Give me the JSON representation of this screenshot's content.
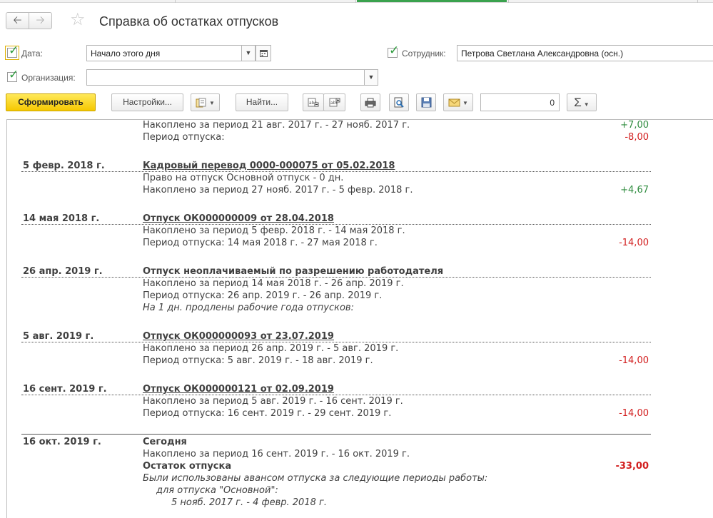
{
  "window": {
    "title": "Справка об остатках отпусков"
  },
  "filters": {
    "date": {
      "label": "Дата:",
      "value": "Начало этого дня"
    },
    "employee": {
      "label": "Сотрудник:",
      "value": "Петрова Светлана Александровна  (осн.)"
    },
    "organization": {
      "label": "Организация:",
      "value": ""
    }
  },
  "toolbar": {
    "generate_label": "Сформировать",
    "settings_label": "Настройки...",
    "find_label": "Найти...",
    "sum_value": "0"
  },
  "report": {
    "top": {
      "accrued": "Накоплено за период 21 авг. 2017 г. - 27 нояб. 2017 г.",
      "accrued_value": "+7,00",
      "period": "Период отпуска:",
      "period_value": "-8,00"
    },
    "e1": {
      "date": "5 февр. 2018 г.",
      "title": "Кадровый перевод 0000-000075 от 05.02.2018",
      "line1": "Право на отпуск Основной отпуск - 0 дн.",
      "line2": "Накоплено за период 27 нояб. 2017 г. - 5 февр. 2018 г.",
      "value2": "+4,67"
    },
    "e2": {
      "date": "14 мая 2018 г.",
      "title": "Отпуск ОК000000009 от 28.04.2018",
      "line1": "Накоплено за период 5 февр. 2018 г. - 14 мая 2018 г.",
      "line2": "Период отпуска: 14 мая 2018 г. - 27 мая 2018 г.",
      "value2": "-14,00"
    },
    "e3": {
      "date": "26 апр. 2019 г.",
      "title": "Отпуск неоплачиваемый по разрешению работодателя",
      "line1": "Накоплено за период 14 мая 2018 г. - 26 апр. 2019 г.",
      "line2": "Период отпуска: 26 апр. 2019 г. - 26 апр. 2019 г.",
      "line3": "На 1 дн. продлены рабочие года отпусков:"
    },
    "e4": {
      "date": "5 авг. 2019 г.",
      "title": "Отпуск ОК000000093 от 23.07.2019",
      "line1": "Накоплено за период 26 апр. 2019 г. - 5 авг. 2019 г.",
      "line2": "Период отпуска: 5 авг. 2019 г. - 18 авг. 2019 г.",
      "value2": "-14,00"
    },
    "e5": {
      "date": "16 сент. 2019 г.",
      "title": "Отпуск ОК000000121 от 02.09.2019",
      "line1": "Накоплено за период 5 авг. 2019 г. - 16 сент. 2019 г.",
      "line2": "Период отпуска: 16 сент. 2019 г. - 29 сент. 2019 г.",
      "value2": "-14,00"
    },
    "e6": {
      "date": "16 окт. 2019 г.",
      "title": "Сегодня",
      "line1": "Накоплено за период 16 сент. 2019 г. - 16 окт. 2019 г.",
      "balance_label": "Остаток отпуска",
      "balance_value": "-33,00",
      "note1": "Были использованы авансом отпуска за следующие периоды работы:",
      "note2": "для отпуска \"Основной\":",
      "note3": "5 нояб. 2017 г. - 4 февр. 2018 г."
    }
  },
  "colors": {
    "positive": "#2e8b3e",
    "negative": "#d21e1e",
    "accent_button": "#f5c800",
    "checkbox": "#2c9a3c"
  },
  "icons": [
    "back-arrow-icon",
    "forward-arrow-icon",
    "favorite-star-icon",
    "calendar-icon",
    "dropdown-arrow-icon",
    "variant-icon",
    "expand-groups-icon",
    "collapse-groups-icon",
    "print-icon",
    "preview-icon",
    "save-icon",
    "email-icon",
    "sigma-icon"
  ]
}
